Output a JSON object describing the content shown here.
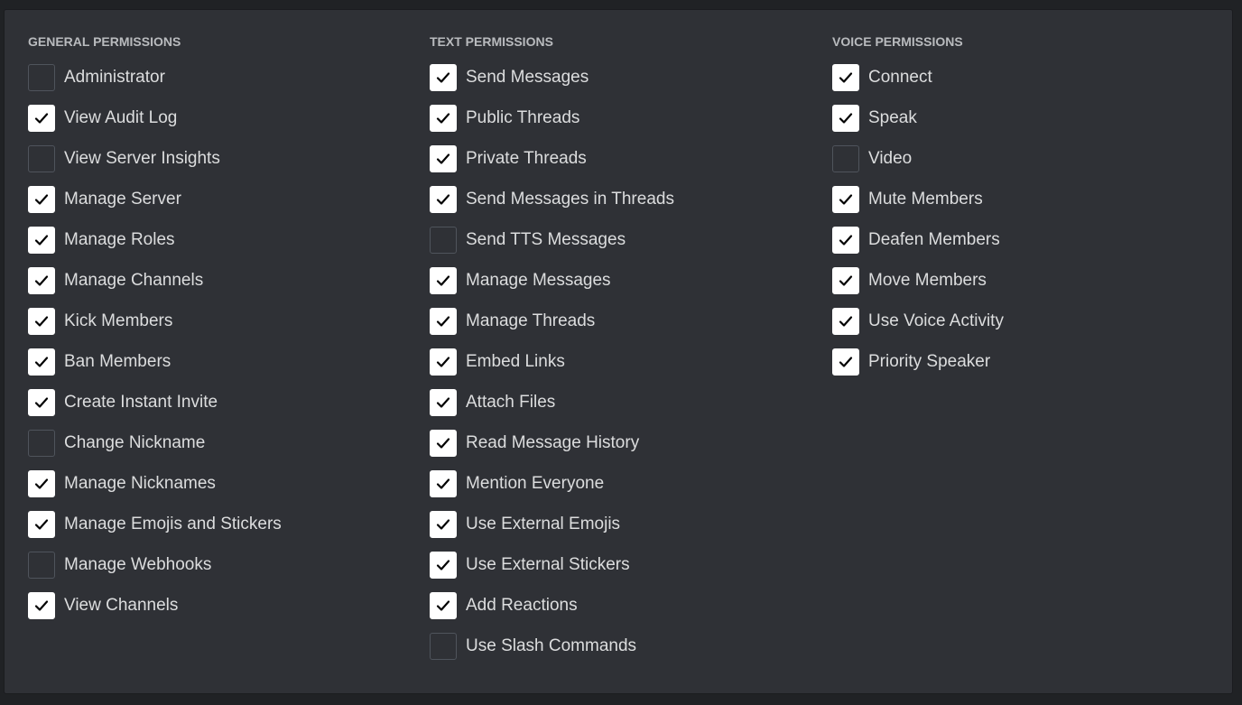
{
  "general": {
    "title": "GENERAL PERMISSIONS",
    "items": [
      {
        "label": "Administrator",
        "checked": false
      },
      {
        "label": "View Audit Log",
        "checked": true
      },
      {
        "label": "View Server Insights",
        "checked": false
      },
      {
        "label": "Manage Server",
        "checked": true
      },
      {
        "label": "Manage Roles",
        "checked": true
      },
      {
        "label": "Manage Channels",
        "checked": true
      },
      {
        "label": "Kick Members",
        "checked": true
      },
      {
        "label": "Ban Members",
        "checked": true
      },
      {
        "label": "Create Instant Invite",
        "checked": true
      },
      {
        "label": "Change Nickname",
        "checked": false
      },
      {
        "label": "Manage Nicknames",
        "checked": true
      },
      {
        "label": "Manage Emojis and Stickers",
        "checked": true
      },
      {
        "label": "Manage Webhooks",
        "checked": false
      },
      {
        "label": "View Channels",
        "checked": true
      }
    ]
  },
  "text": {
    "title": "TEXT PERMISSIONS",
    "items": [
      {
        "label": "Send Messages",
        "checked": true
      },
      {
        "label": "Public Threads",
        "checked": true
      },
      {
        "label": "Private Threads",
        "checked": true
      },
      {
        "label": "Send Messages in Threads",
        "checked": true
      },
      {
        "label": "Send TTS Messages",
        "checked": false
      },
      {
        "label": "Manage Messages",
        "checked": true
      },
      {
        "label": "Manage Threads",
        "checked": true
      },
      {
        "label": "Embed Links",
        "checked": true
      },
      {
        "label": "Attach Files",
        "checked": true
      },
      {
        "label": "Read Message History",
        "checked": true
      },
      {
        "label": "Mention Everyone",
        "checked": true
      },
      {
        "label": "Use External Emojis",
        "checked": true
      },
      {
        "label": "Use External Stickers",
        "checked": true
      },
      {
        "label": "Add Reactions",
        "checked": true
      },
      {
        "label": "Use Slash Commands",
        "checked": false
      }
    ]
  },
  "voice": {
    "title": "VOICE PERMISSIONS",
    "items": [
      {
        "label": "Connect",
        "checked": true
      },
      {
        "label": "Speak",
        "checked": true
      },
      {
        "label": "Video",
        "checked": false
      },
      {
        "label": "Mute Members",
        "checked": true
      },
      {
        "label": "Deafen Members",
        "checked": true
      },
      {
        "label": "Move Members",
        "checked": true
      },
      {
        "label": "Use Voice Activity",
        "checked": true
      },
      {
        "label": "Priority Speaker",
        "checked": true
      }
    ]
  },
  "icons": {
    "checked": "check-icon"
  },
  "colors": {
    "panel_bg": "#2f3136",
    "text": "#dcddde",
    "header": "#b9bbbe",
    "checkbox_checked": "#ffffff",
    "checkbox_border": "#4f545c"
  }
}
